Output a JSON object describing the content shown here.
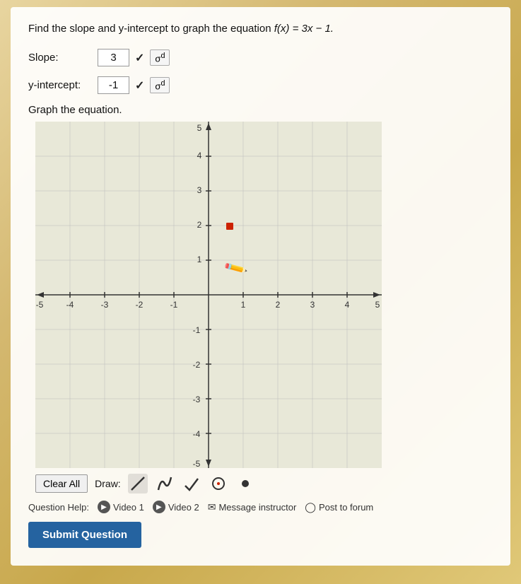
{
  "page": {
    "question": "Find the slope and y-intercept to graph the equation",
    "equation": "f(x) = 3x − 1.",
    "slope_label": "Slope:",
    "slope_value": "3",
    "y_intercept_label": "y-intercept:",
    "y_intercept_value": "-1",
    "graph_label": "Graph the equation.",
    "toolbar": {
      "clear_all": "Clear All",
      "draw_label": "Draw:",
      "tools": [
        "line",
        "curve",
        "checkmark",
        "circle",
        "dot"
      ]
    },
    "help_section": {
      "label": "Question Help:",
      "items": [
        {
          "icon": "▶",
          "text": "Video 1"
        },
        {
          "icon": "▶",
          "text": "Video 2"
        },
        {
          "icon": "✉",
          "text": "Message instructor"
        },
        {
          "icon": "◯",
          "text": "Post to forum"
        }
      ]
    },
    "submit_button": "Submit Question",
    "grid": {
      "x_min": -5,
      "x_max": 5,
      "y_min": -5,
      "y_max": 5,
      "x_labels": [
        "-5",
        "-4",
        "-3",
        "-2",
        "-1",
        "",
        "1",
        "2",
        "3",
        "4",
        "5"
      ],
      "y_labels": [
        "-5",
        "-4",
        "-3",
        "-2",
        "-1",
        "1",
        "2",
        "3",
        "4",
        "5"
      ]
    }
  }
}
